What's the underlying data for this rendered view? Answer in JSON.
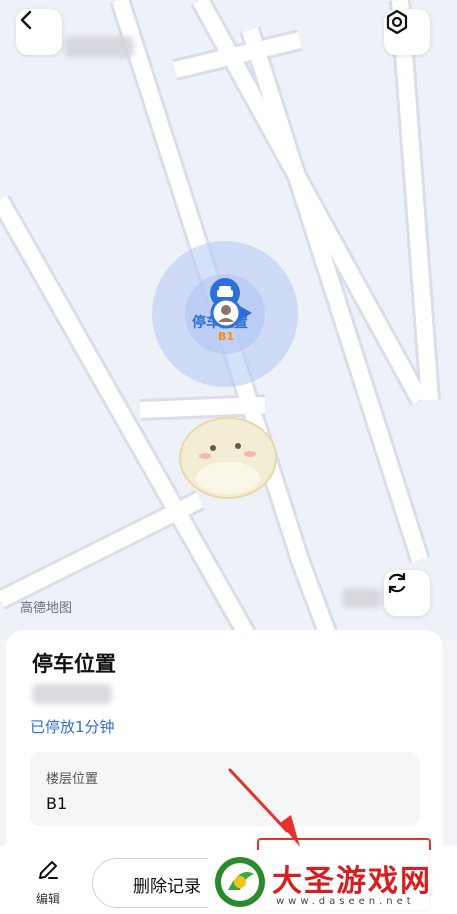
{
  "map": {
    "marker_label": "停车位置",
    "floor_tag": "B1",
    "attribution": "高德地图",
    "icons": {
      "back": "chevron-left-icon",
      "settings": "gear-icon",
      "refresh": "refresh-icon"
    }
  },
  "sheet": {
    "title": "停车位置",
    "parked_duration": "已停放1分钟",
    "floor_label": "楼层位置",
    "floor_value": "B1"
  },
  "bottom_bar": {
    "edit_label": "编辑",
    "delete_label": "删除记录"
  },
  "watermark": {
    "name": "大圣游戏网",
    "url": "www.daseen.net"
  },
  "colors": {
    "accent_blue": "#2f6fd6",
    "annotation_red": "#e5322d",
    "map_road": "#ffffff",
    "map_bg": "#eef1f8"
  }
}
